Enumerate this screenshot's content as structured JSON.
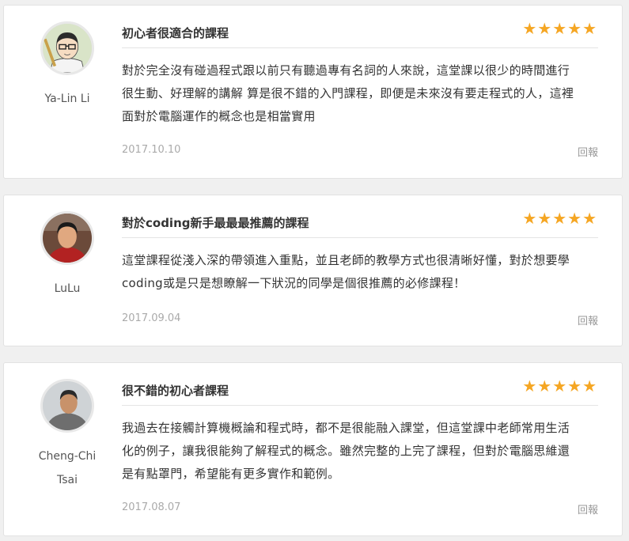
{
  "reviews": [
    {
      "author": "Ya-Lin Li",
      "author_lines": [
        "Ya-Lin Li"
      ],
      "title": "初心者很適合的課程",
      "rating": 5,
      "body_lines": [
        "對於完全沒有碰過程式跟以前只有聽過專有名詞的人來說，這堂課以很少的時間進行",
        "很生動、好理解的講解 算是很不錯的入門課程，即便是未來沒有要走程式的人，這裡",
        "面對於電腦運作的概念也是相當實用"
      ],
      "date": "2017.10.10",
      "reply_label": "回報"
    },
    {
      "author": "LuLu",
      "author_lines": [
        "LuLu"
      ],
      "title": "對於coding新手最最最推薦的課程",
      "rating": 5,
      "body_lines": [
        "這堂課程從淺入深的帶領進入重點，並且老師的教學方式也很清晰好懂，對於想要學",
        "coding或是只是想瞭解一下狀況的同學是個很推薦的必修課程！"
      ],
      "date": "2017.09.04",
      "reply_label": "回報"
    },
    {
      "author": "Cheng-Chi Tsai",
      "author_lines": [
        "Cheng-Chi",
        "Tsai"
      ],
      "title": "很不錯的初心者課程",
      "rating": 5,
      "body_lines": [
        "我過去在接觸計算機概論和程式時，都不是很能融入課堂，但這堂課中老師常用生活",
        "化的例子，讓我很能夠了解程式的概念。雖然完整的上完了課程，但對於電腦思維還",
        "是有點罩門，希望能有更多實作和範例。"
      ],
      "date": "2017.08.07",
      "reply_label": "回報"
    }
  ],
  "icons": {
    "star": "star-icon"
  },
  "colors": {
    "star": "#f5a623",
    "date": "#aaaaaa",
    "divider": "#e4e4e4"
  }
}
